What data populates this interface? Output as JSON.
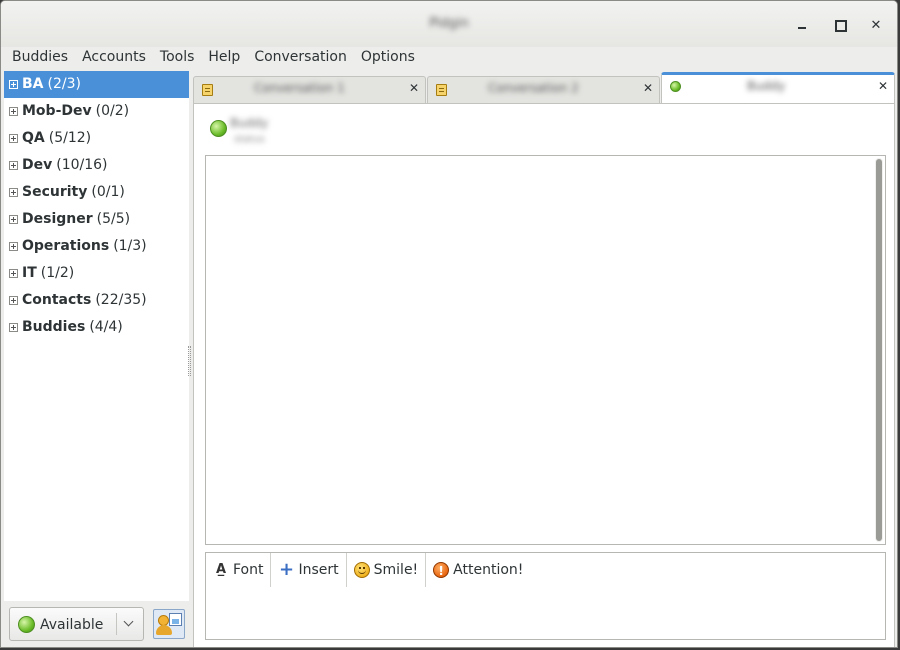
{
  "window": {
    "title": "Pidgin",
    "controls": {
      "minimize": "",
      "maximize": "",
      "close": ""
    }
  },
  "menu": [
    "Buddies",
    "Accounts",
    "Tools",
    "Help",
    "Conversation",
    "Options"
  ],
  "buddy_groups": [
    {
      "name": "BA",
      "count": "(2/3)",
      "selected": true
    },
    {
      "name": "Mob-Dev",
      "count": "(0/2)"
    },
    {
      "name": "QA",
      "count": "(5/12)"
    },
    {
      "name": "Dev",
      "count": "(10/16)"
    },
    {
      "name": "Security",
      "count": "(0/1)"
    },
    {
      "name": "Designer",
      "count": "(5/5)"
    },
    {
      "name": "Operations",
      "count": "(1/3)"
    },
    {
      "name": "IT",
      "count": "(1/2)"
    },
    {
      "name": "Contacts",
      "count": "(22/35)"
    },
    {
      "name": "Buddies",
      "count": "(4/4)"
    }
  ],
  "status": {
    "label": "Available",
    "color": "#6cbd2a"
  },
  "tabs": [
    {
      "label": "Conversation 1",
      "icon": "note-icon",
      "active": false
    },
    {
      "label": "Conversation 2",
      "icon": "note-icon",
      "active": false
    },
    {
      "label": "Buddy",
      "icon": "online-status-icon",
      "active": true
    }
  ],
  "conversation": {
    "name": "Buddy",
    "status_text": "status"
  },
  "compose_toolbar": {
    "font": "Font",
    "insert": "Insert",
    "smile": "Smile!",
    "attention": "Attention!"
  },
  "colors": {
    "selection": "#4a90d9",
    "online": "#6cbd2a"
  }
}
